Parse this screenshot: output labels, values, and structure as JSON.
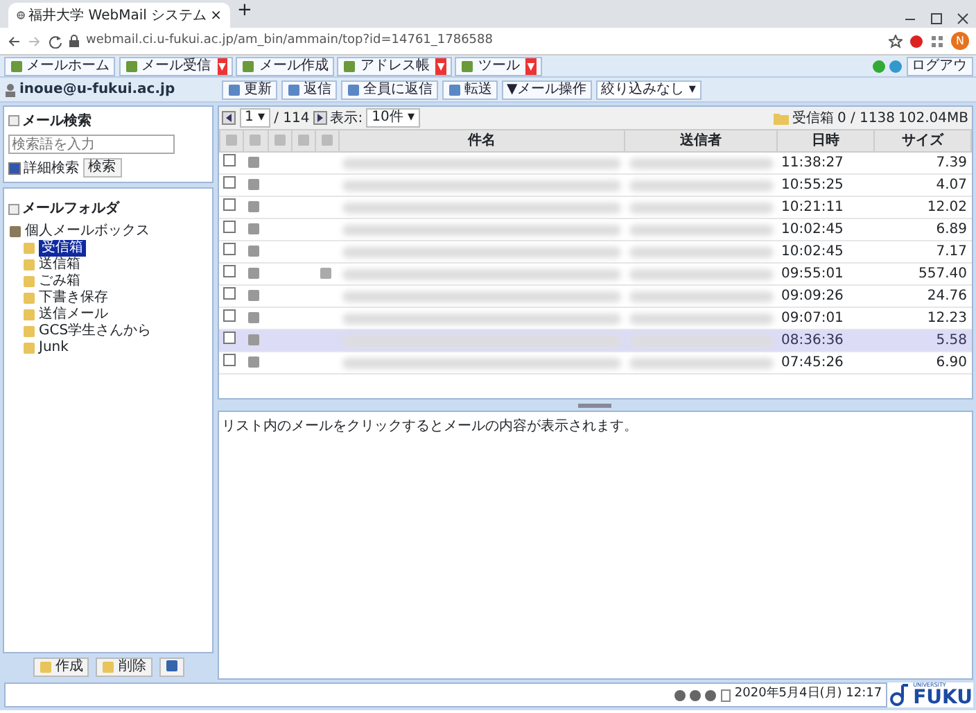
{
  "browser": {
    "tab_title": "福井大学 WebMail システム",
    "tab_close": "×",
    "new_tab": "+",
    "url": "webmail.ci.u-fukui.ac.jp/am_bin/ammain/top?id=14761_1786588",
    "profile_initial": "N"
  },
  "app_toolbar": [
    {
      "label": "メールホーム",
      "dropdown": false
    },
    {
      "label": "メール受信",
      "dropdown": true
    },
    {
      "label": "メール作成",
      "dropdown": false
    },
    {
      "label": "アドレス帳",
      "dropdown": true
    },
    {
      "label": "ツール",
      "dropdown": true
    }
  ],
  "dropdown_mark": "▼",
  "logout": "ログアウ",
  "user": "inoue@u-fukui.ac.jp",
  "mail_actions": [
    {
      "label": "更新",
      "kind": "button"
    },
    {
      "label": "返信",
      "kind": "button"
    },
    {
      "label": "全員に返信",
      "kind": "button"
    },
    {
      "label": "転送",
      "kind": "button"
    },
    {
      "label": "▼メール操作",
      "kind": "menu"
    },
    {
      "label": "絞り込みなし ▾",
      "kind": "select"
    }
  ],
  "search": {
    "title": "メール検索",
    "placeholder": "検索語を入力",
    "detail_label": "詳細検索",
    "detail_checked": true,
    "button": "検索"
  },
  "folders": {
    "title": "メールフォルダ",
    "tree": [
      {
        "label": "個人メールボックス",
        "selected": false,
        "children": [
          {
            "label": "受信箱",
            "selected": true
          },
          {
            "label": "送信箱",
            "selected": false
          },
          {
            "label": "ごみ箱",
            "selected": false
          },
          {
            "label": "下書き保存",
            "selected": false
          },
          {
            "label": "送信メール",
            "selected": false
          },
          {
            "label": "GCS学生さんから",
            "selected": false
          },
          {
            "label": "Junk",
            "selected": false
          }
        ]
      }
    ]
  },
  "folder_buttons": [
    "作成",
    "削除"
  ],
  "pager": {
    "page": "1 ▾",
    "total": "/ 114",
    "display_label": "表示:",
    "display_value": "10件 ▾"
  },
  "mailbox_info": {
    "folder": "受信箱",
    "count": "0 / 1138",
    "size": "102.04MB"
  },
  "columns": [
    "件名",
    "送信者",
    "日時",
    "サイズ"
  ],
  "rows": [
    {
      "time": "11:38:27",
      "size": "7.39",
      "attachment": false,
      "selected": false,
      "checked": false
    },
    {
      "time": "10:55:25",
      "size": "4.07",
      "attachment": false,
      "selected": false,
      "checked": false
    },
    {
      "time": "10:21:11",
      "size": "12.02",
      "attachment": false,
      "selected": false,
      "checked": false
    },
    {
      "time": "10:02:45",
      "size": "6.89",
      "attachment": false,
      "selected": false,
      "checked": false
    },
    {
      "time": "10:02:45",
      "size": "7.17",
      "attachment": false,
      "selected": false,
      "checked": false
    },
    {
      "time": "09:55:01",
      "size": "557.40",
      "attachment": true,
      "selected": false,
      "checked": false
    },
    {
      "time": "09:09:26",
      "size": "24.76",
      "attachment": false,
      "selected": false,
      "checked": false
    },
    {
      "time": "09:07:01",
      "size": "12.23",
      "attachment": false,
      "selected": false,
      "checked": false
    },
    {
      "time": "08:36:36",
      "size": "5.58",
      "attachment": false,
      "selected": true,
      "checked": false
    },
    {
      "time": "07:45:26",
      "size": "6.90",
      "attachment": false,
      "selected": false,
      "checked": false
    }
  ],
  "preview_message": "リスト内のメールをクリックするとメールの内容が表示されます。",
  "status": {
    "datetime": "2020年5月4日(月) 12:17",
    "logo_small": "UNIVERSITY",
    "logo_text": "FUKU"
  }
}
